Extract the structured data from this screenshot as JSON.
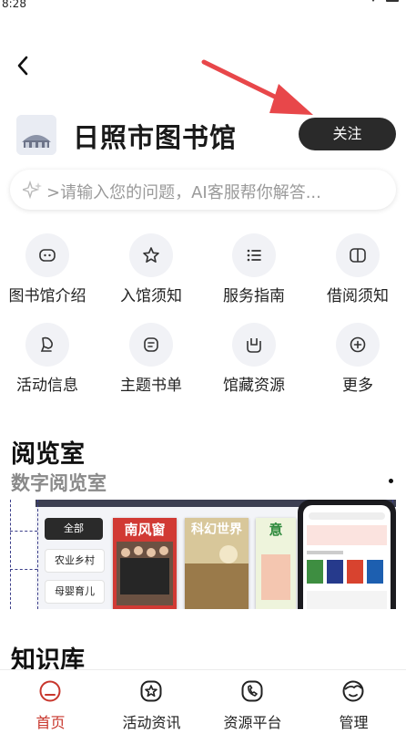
{
  "status_bar": {
    "time": "8:28"
  },
  "header": {
    "library_name": "日照市图书馆",
    "follow_label": "关注"
  },
  "search": {
    "placeholder": ">请输入您的问题，AI客服帮你解答..."
  },
  "quick_links": [
    {
      "label": "图书馆介绍",
      "icon": "library-intro-icon"
    },
    {
      "label": "入馆须知",
      "icon": "star-icon"
    },
    {
      "label": "服务指南",
      "icon": "list-icon"
    },
    {
      "label": "借阅须知",
      "icon": "book-icon"
    },
    {
      "label": "活动信息",
      "icon": "activity-icon"
    },
    {
      "label": "主题书单",
      "icon": "booklist-icon"
    },
    {
      "label": "馆藏资源",
      "icon": "collection-icon"
    },
    {
      "label": "更多",
      "icon": "plus-circle-icon"
    }
  ],
  "reading_room": {
    "title": "阅览室",
    "subtitle": "数字阅览室",
    "banner": {
      "menu_items": [
        "全部",
        "农业乡村",
        "母婴育儿"
      ],
      "magazines": [
        "南风窗",
        "科幻世界",
        "意"
      ]
    }
  },
  "knowledge": {
    "title": "知识库"
  },
  "bottom_nav": [
    {
      "label": "首页",
      "icon": "home-icon",
      "active": true
    },
    {
      "label": "活动资讯",
      "icon": "activity-news-icon",
      "active": false
    },
    {
      "label": "资源平台",
      "icon": "resource-platform-icon",
      "active": false
    },
    {
      "label": "管理",
      "icon": "manage-icon",
      "active": false
    }
  ],
  "colors": {
    "accent": "#c8362c",
    "follow_button": "#2a2a2a",
    "annotation_arrow": "#e8474a"
  }
}
